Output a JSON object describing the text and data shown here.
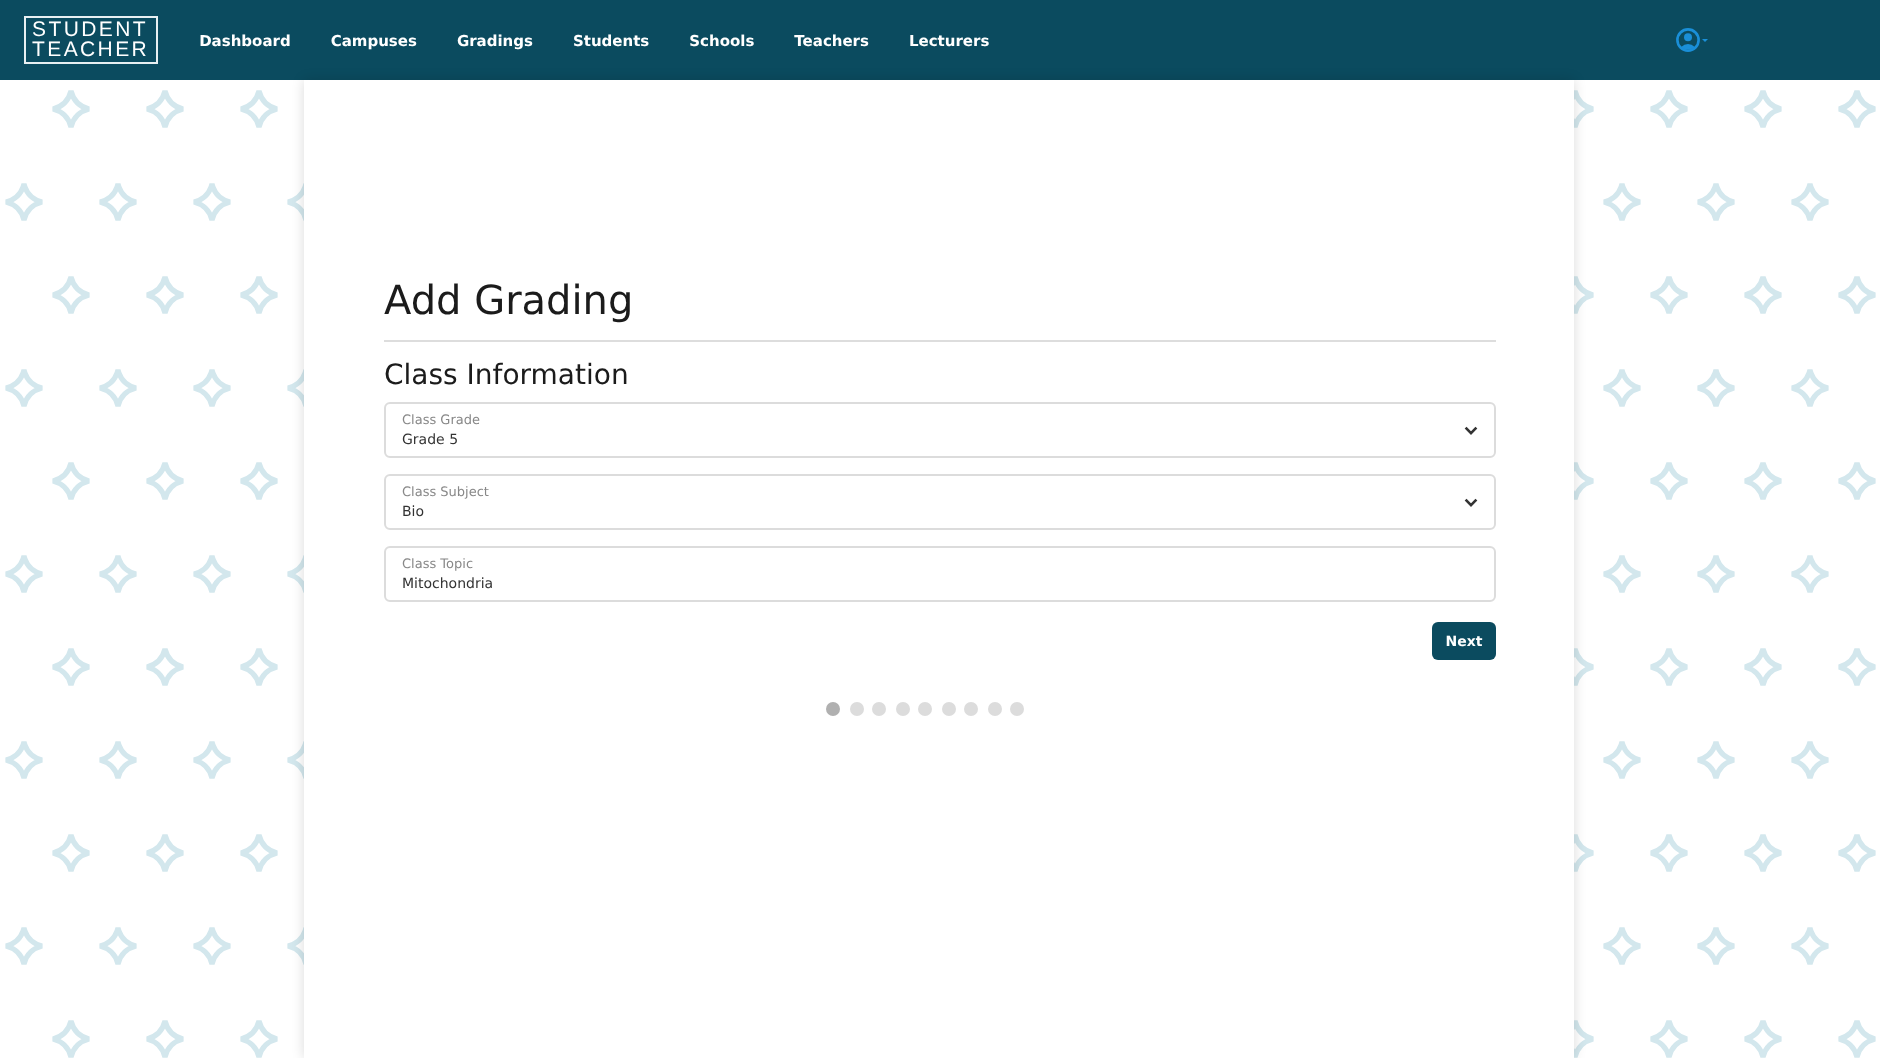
{
  "nav": {
    "logo": [
      "STUDENT",
      "TEACHER"
    ],
    "items": [
      {
        "label": "Dashboard",
        "selected": false
      },
      {
        "label": "Campuses",
        "selected": false
      },
      {
        "label": "Gradings",
        "selected": false
      },
      {
        "label": "Students",
        "selected": false
      },
      {
        "label": "Schools",
        "selected": false
      },
      {
        "label": "Teachers",
        "selected": false
      },
      {
        "label": "Lecturers",
        "selected": false
      }
    ]
  },
  "page": {
    "title": "Add Grading",
    "section": "Class Information",
    "fields": [
      {
        "kind": "select",
        "label": "Class Grade",
        "value": "Grade 5"
      },
      {
        "kind": "select",
        "label": "Class Subject",
        "value": "Bio"
      },
      {
        "kind": "text",
        "label": "Class Topic",
        "value": "Mitochondria"
      }
    ],
    "next_button": "Next",
    "steps": [
      {
        "selected": true
      },
      {
        "selected": false
      },
      {
        "selected": false
      },
      {
        "selected": false
      },
      {
        "selected": false
      },
      {
        "selected": false
      },
      {
        "selected": false
      },
      {
        "selected": false
      },
      {
        "selected": false
      }
    ]
  }
}
